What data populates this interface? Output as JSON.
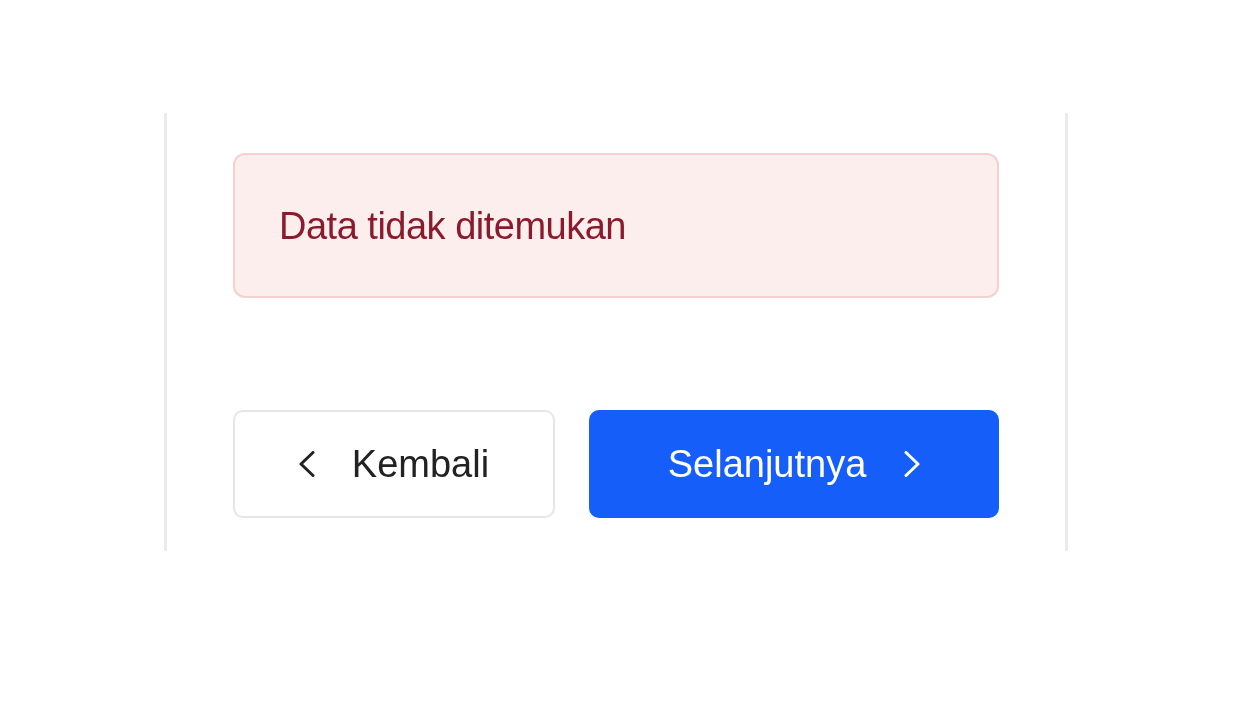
{
  "alert": {
    "message": "Data tidak ditemukan"
  },
  "buttons": [
    {
      "kind": "back",
      "label": "Kembali"
    },
    {
      "kind": "next",
      "label": "Selanjutnya"
    }
  ]
}
